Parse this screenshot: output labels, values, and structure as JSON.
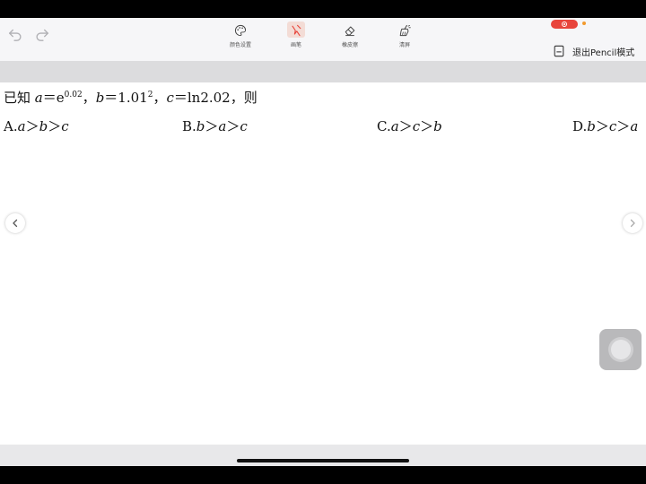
{
  "toolbar": {
    "tools": [
      {
        "id": "palette",
        "label": "颜色设置",
        "icon": "palette-icon"
      },
      {
        "id": "pen",
        "label": "画笔",
        "icon": "pen-icon",
        "active": true
      },
      {
        "id": "eraser",
        "label": "橡皮擦",
        "icon": "eraser-icon"
      },
      {
        "id": "clear",
        "label": "清屏",
        "icon": "broom-icon"
      }
    ],
    "exit_label": "退出Pencil模式"
  },
  "question": {
    "prefix": "已知 ",
    "a_var": "a",
    "a_eq": "＝e",
    "a_exp": "0.02",
    "sep1": "，",
    "b_var": "b",
    "b_eq": "＝1.01",
    "b_exp": "2",
    "sep2": "，",
    "c_var": "c",
    "c_eq": "＝ln2.02，则"
  },
  "options": [
    {
      "letter": "A.",
      "v1": "a",
      "g1": "＞",
      "v2": "b",
      "g2": "＞",
      "v3": "c"
    },
    {
      "letter": "B.",
      "v1": "b",
      "g1": "＞",
      "v2": "a",
      "g2": "＞",
      "v3": "c"
    },
    {
      "letter": "C.",
      "v1": "a",
      "g1": "＞",
      "v2": "c",
      "g2": "＞",
      "v3": "b"
    },
    {
      "letter": "D.",
      "v1": "b",
      "g1": "＞",
      "v2": "c",
      "g2": "＞",
      "v3": "a"
    }
  ],
  "colors": {
    "accent": "#e8453c",
    "pen_active_bg": "#f3dcd6",
    "toolbar_bg": "#f6f6f8"
  }
}
